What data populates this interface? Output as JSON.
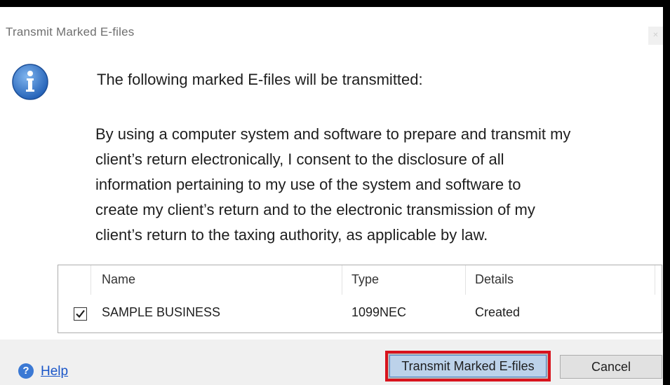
{
  "dialog": {
    "title": "Transmit Marked E-files",
    "heading": "The following marked E-files will be transmitted:",
    "consent_lines": [
      "By using a computer system and software to prepare and transmit my",
      "client’s return electronically, I consent to the disclosure of all",
      "information pertaining to my use of the system and software to",
      "create my client’s return and to the electronic transmission of my",
      "client’s return to the taxing authority, as applicable by law."
    ],
    "icon": "info-icon"
  },
  "table": {
    "columns": [
      "Name",
      "Type",
      "Details"
    ],
    "rows": [
      {
        "checked": true,
        "name": "SAMPLE BUSINESS",
        "type": "1099NEC",
        "details": "Created"
      }
    ]
  },
  "footer": {
    "help_label": "Help",
    "help_icon": "help-icon",
    "transmit_label": "Transmit Marked E-files",
    "cancel_label": "Cancel"
  },
  "colors": {
    "highlight_border": "#d8131d",
    "info_icon": "#2f6fc9",
    "link": "#1a56c8",
    "primary_button": "#bcd2ea"
  }
}
